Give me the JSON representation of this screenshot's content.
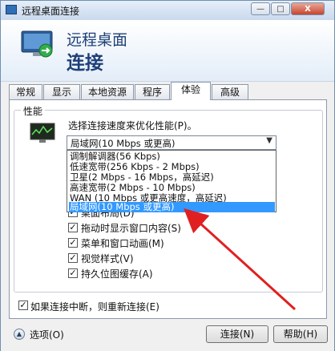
{
  "window": {
    "title": "远程桌面连接",
    "minimize_glyph": "—",
    "maximize_glyph": "□",
    "close_glyph": "X"
  },
  "banner": {
    "line1": "远程桌面",
    "line2": "连接"
  },
  "tabs": [
    "常规",
    "显示",
    "本地资源",
    "程序",
    "体验",
    "高级"
  ],
  "active_tab": "体验",
  "performance": {
    "group_label": "性能",
    "select_label": "选择连接速度来优化性能(P)。",
    "selected_value": "局域网(10 Mbps 或更高)",
    "options": [
      "调制解调器(56 Kbps)",
      "低速宽带(256 Kbps - 2 Mbps)",
      "卫星(2 Mbps - 16 Mbps，高延迟)",
      "高速宽带(2 Mbps - 10 Mbps)",
      "WAN (10 Mbps 或更高速度，高延迟)",
      "局域网(10 Mbps 或更高)"
    ],
    "highlighted_option_index": 5,
    "checkboxes": [
      {
        "label": "桌面布局(D)",
        "checked": true
      },
      {
        "label": "拖动时显示窗口内容(S)",
        "checked": true
      },
      {
        "label": "菜单和窗口动画(M)",
        "checked": true
      },
      {
        "label": "视觉样式(V)",
        "checked": true
      },
      {
        "label": "持久位图缓存(A)",
        "checked": true
      }
    ]
  },
  "reconnect": {
    "label": "如果连接中断，则重新连接(E)",
    "checked": true
  },
  "footer": {
    "options_label": "选项(O)",
    "connect_label": "连接(N)",
    "help_label": "帮助(H)"
  },
  "colors": {
    "highlight": "#3399ff",
    "annotation_arrow": "#e02020",
    "banner_text": "#1e3f78"
  }
}
